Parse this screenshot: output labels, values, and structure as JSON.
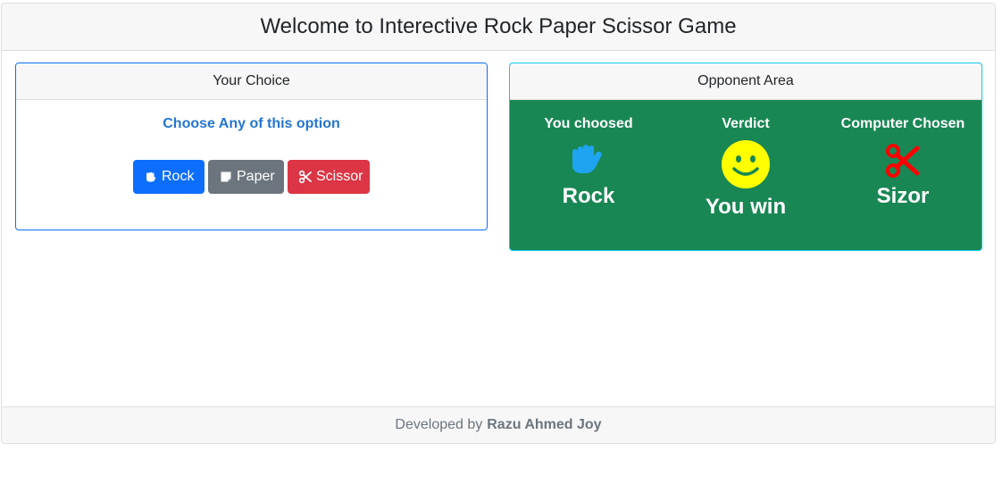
{
  "header": {
    "title": "Welcome to Interective Rock Paper Scissor Game"
  },
  "choice_panel": {
    "title": "Your Choice",
    "prompt": "Choose Any of this option",
    "buttons": {
      "rock": {
        "label": "Rock",
        "icon": "hand-rock-icon",
        "color": "#0d6efd"
      },
      "paper": {
        "label": "Paper",
        "icon": "sticky-note-icon",
        "color": "#6c757d"
      },
      "scissor": {
        "label": "Scissor",
        "icon": "scissors-icon",
        "color": "#dc3545"
      }
    }
  },
  "opponent_panel": {
    "title": "Opponent Area",
    "background": "#198754",
    "columns": {
      "you": {
        "title": "You choosed",
        "value": "Rock",
        "icon": "hand-icon",
        "icon_color": "#1fa4f2"
      },
      "verdict": {
        "title": "Verdict",
        "value": "You win",
        "icon": "smiley-face-icon",
        "icon_color": "#ffff00"
      },
      "computer": {
        "title": "Computer Chosen",
        "value": "Sizor",
        "icon": "scissors-icon",
        "icon_color": "#ff0000"
      }
    }
  },
  "footer": {
    "prefix": "Developed by",
    "author": "Razu Ahmed Joy"
  }
}
